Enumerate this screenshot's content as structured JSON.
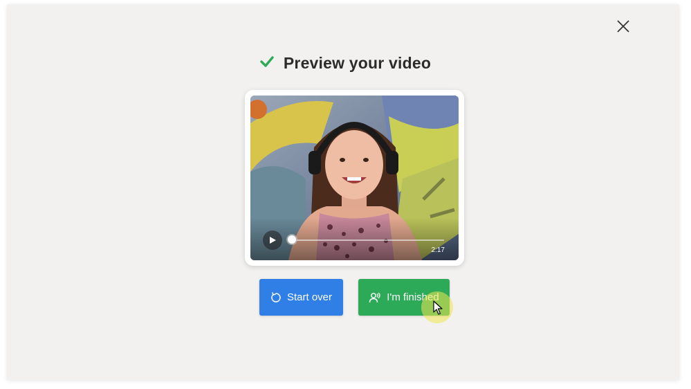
{
  "dialog": {
    "title": "Preview your video",
    "close_icon": "close-icon",
    "check_icon": "checkmark-icon",
    "check_color": "#2daa57"
  },
  "video": {
    "duration": "2:17",
    "progress": 0.0,
    "play_icon": "play-icon"
  },
  "buttons": {
    "start_over": {
      "label": "Start over",
      "icon": "restart-icon",
      "color": "#2f7fe6"
    },
    "finished": {
      "label": "I'm finished",
      "icon": "people-icon",
      "color": "#2daa57"
    }
  },
  "colors": {
    "background": "#f2f1ef",
    "title_text": "#2b2b2b"
  }
}
